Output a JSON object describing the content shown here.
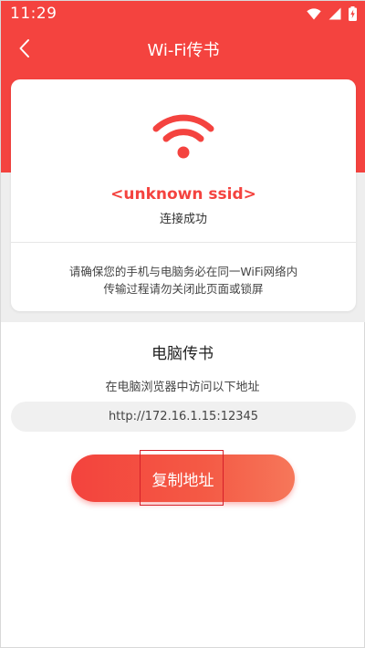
{
  "status_bar": {
    "time": "11:29",
    "icons": [
      "wifi-signal-icon",
      "cell-signal-icon",
      "battery-charging-icon"
    ]
  },
  "header": {
    "back_icon": "chevron-left-icon",
    "title": "Wi-Fi传书"
  },
  "connection_card": {
    "icon": "wifi-icon",
    "ssid": "<unknown ssid>",
    "status": "连接成功",
    "note_line1": "请确保您的手机与电脑务必在同一WiFi网络内",
    "note_line2": "传输过程请勿关闭此页面或锁屏"
  },
  "transfer": {
    "title": "电脑传书",
    "instruction": "在电脑浏览器中访问以下地址",
    "address": "http://172.16.1.15:12345",
    "copy_button_label": "复制地址"
  },
  "colors": {
    "accent": "#f4433f",
    "card_bg": "#ffffff",
    "gray_band": "#eeeeee"
  }
}
